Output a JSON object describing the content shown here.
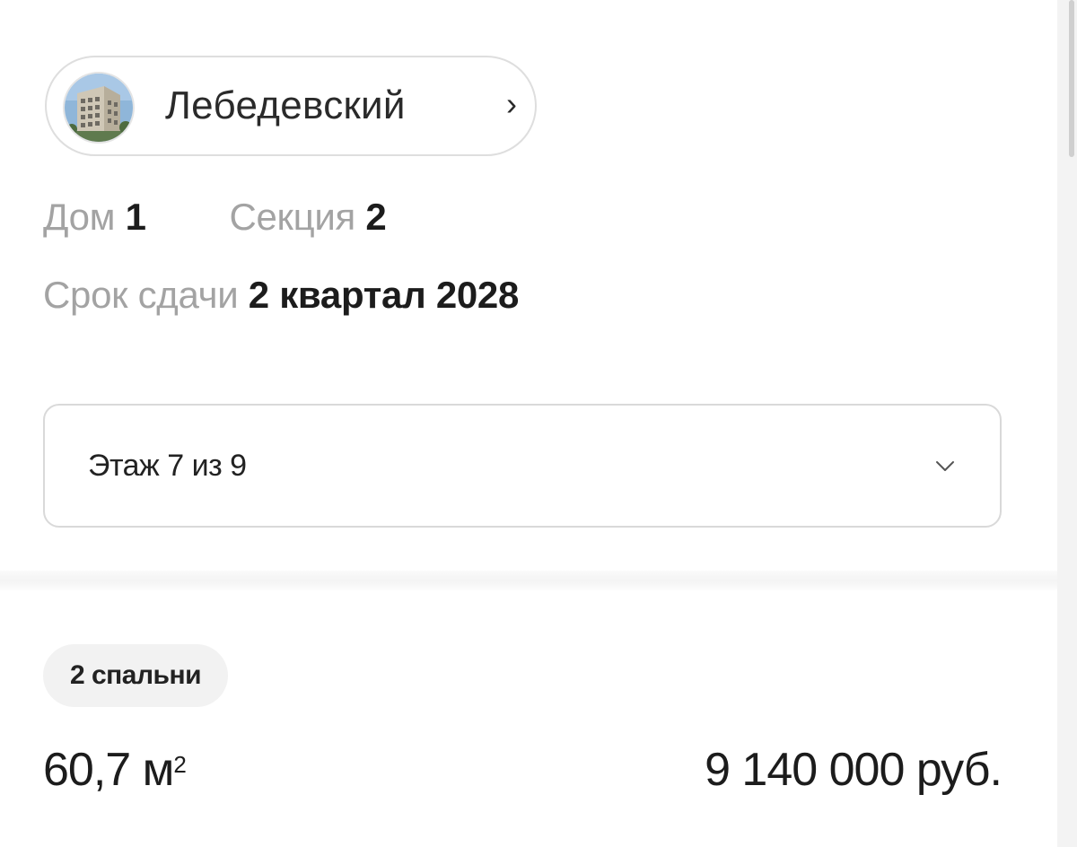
{
  "project": {
    "name": "Лебедевский",
    "arrow": "›",
    "avatar_icon": "building-photo-icon"
  },
  "house": {
    "label": "Дом",
    "value": "1"
  },
  "section": {
    "label": "Секция",
    "value": "2"
  },
  "deadline": {
    "label": "Срок сдачи",
    "value": "2 квартал 2028"
  },
  "floor_select": {
    "value": "Этаж 7 из 9",
    "icon": "chevron-down-icon"
  },
  "apartment": {
    "bedrooms": "2 спальни",
    "area_value": "60,7 м",
    "area_unit_sup": "2",
    "price": "9 140 000 руб."
  },
  "colors": {
    "label_gray": "#a3a3a3",
    "text_dark": "#1c1c1c",
    "border": "#d9d9d9",
    "tag_bg": "#f2f2f2"
  }
}
